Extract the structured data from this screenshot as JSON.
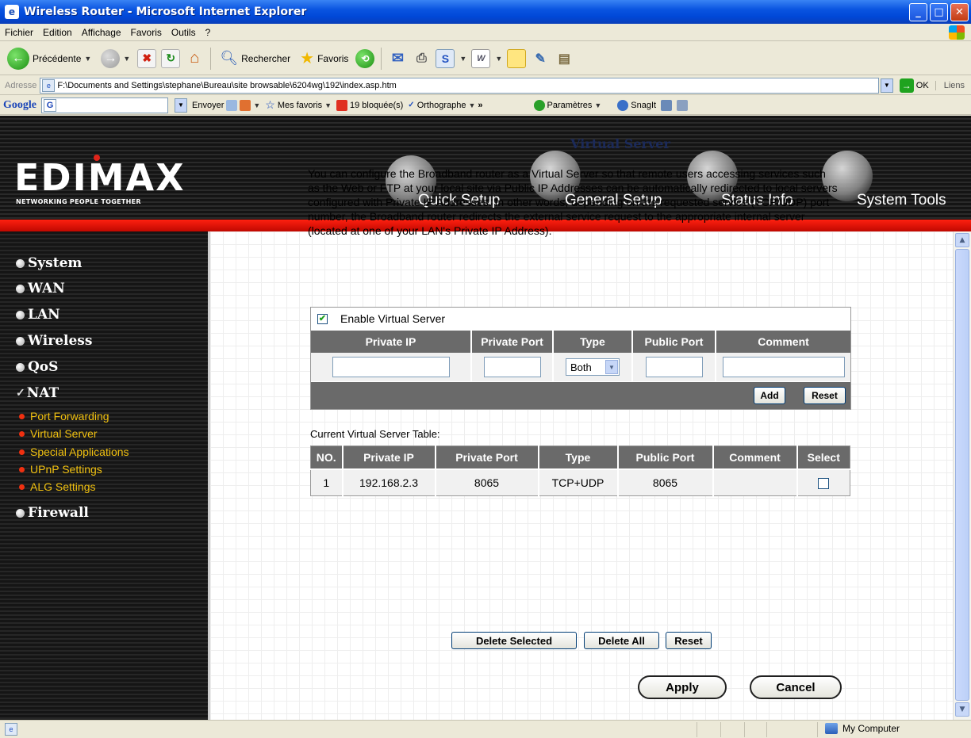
{
  "window": {
    "title": "Wireless Router - Microsoft Internet Explorer",
    "minimize": "_",
    "maximize": "□",
    "close": "✕"
  },
  "menu": [
    "Fichier",
    "Edition",
    "Affichage",
    "Favoris",
    "Outils",
    "?"
  ],
  "toolbar": {
    "back_label": "Précédente",
    "search_label": "Rechercher",
    "favorites_label": "Favoris"
  },
  "address": {
    "label": "Adresse",
    "url": "F:\\Documents and Settings\\stephane\\Bureau\\site browsable\\6204wg\\192\\index.asp.htm",
    "go_label": "OK",
    "links_label": "Liens"
  },
  "googlebar": {
    "logo": "Google",
    "send_label": "Envoyer",
    "bookmarks_label": "Mes favoris",
    "blocked_label": "19 bloquée(s)",
    "spell_label": "Orthographe",
    "settings_label": "Paramètres",
    "snagit_label": "SnagIt"
  },
  "router": {
    "logo": "EDIMAX",
    "tagline": "NETWORKING PEOPLE TOGETHER",
    "nav": [
      "Quick Setup",
      "General Setup",
      "Status Info",
      "System Tools"
    ]
  },
  "sidebar": {
    "items": [
      "System",
      "WAN",
      "LAN",
      "Wireless",
      "QoS",
      "NAT"
    ],
    "nat_subitems": [
      "Port Forwarding",
      "Virtual Server",
      "Special Applications",
      "UPnP Settings",
      "ALG Settings"
    ],
    "firewall": "Firewall"
  },
  "page": {
    "title": "Virtual Server",
    "description": "You can configure the Broadband router as a Virtual Server so that remote users accessing services such as the Web or FTP at your local site via Public IP Addresses can be automatically redirected to local servers configured with Private IP Addresses. In other words, depending on the requested service (TCP/UDP) port number, the Broadband router redirects the external service request to the appropriate internal server (located at one of your LAN's Private IP Address)."
  },
  "form": {
    "enable_label": "Enable Virtual Server",
    "enable_checked": true,
    "headers": [
      "Private IP",
      "Private Port",
      "Type",
      "Public Port",
      "Comment"
    ],
    "type_value": "Both",
    "add_label": "Add",
    "reset_label": "Reset"
  },
  "table": {
    "caption": "Current Virtual Server Table:",
    "headers": [
      "NO.",
      "Private IP",
      "Private Port",
      "Type",
      "Public Port",
      "Comment",
      "Select"
    ],
    "rows": [
      {
        "no": "1",
        "private_ip": "192.168.2.3",
        "private_port": "8065",
        "type": "TCP+UDP",
        "public_port": "8065",
        "comment": ""
      }
    ]
  },
  "actions": {
    "delete_selected": "Delete Selected",
    "delete_all": "Delete All",
    "reset": "Reset",
    "apply": "Apply",
    "cancel": "Cancel"
  },
  "status": {
    "zone": "My Computer"
  }
}
